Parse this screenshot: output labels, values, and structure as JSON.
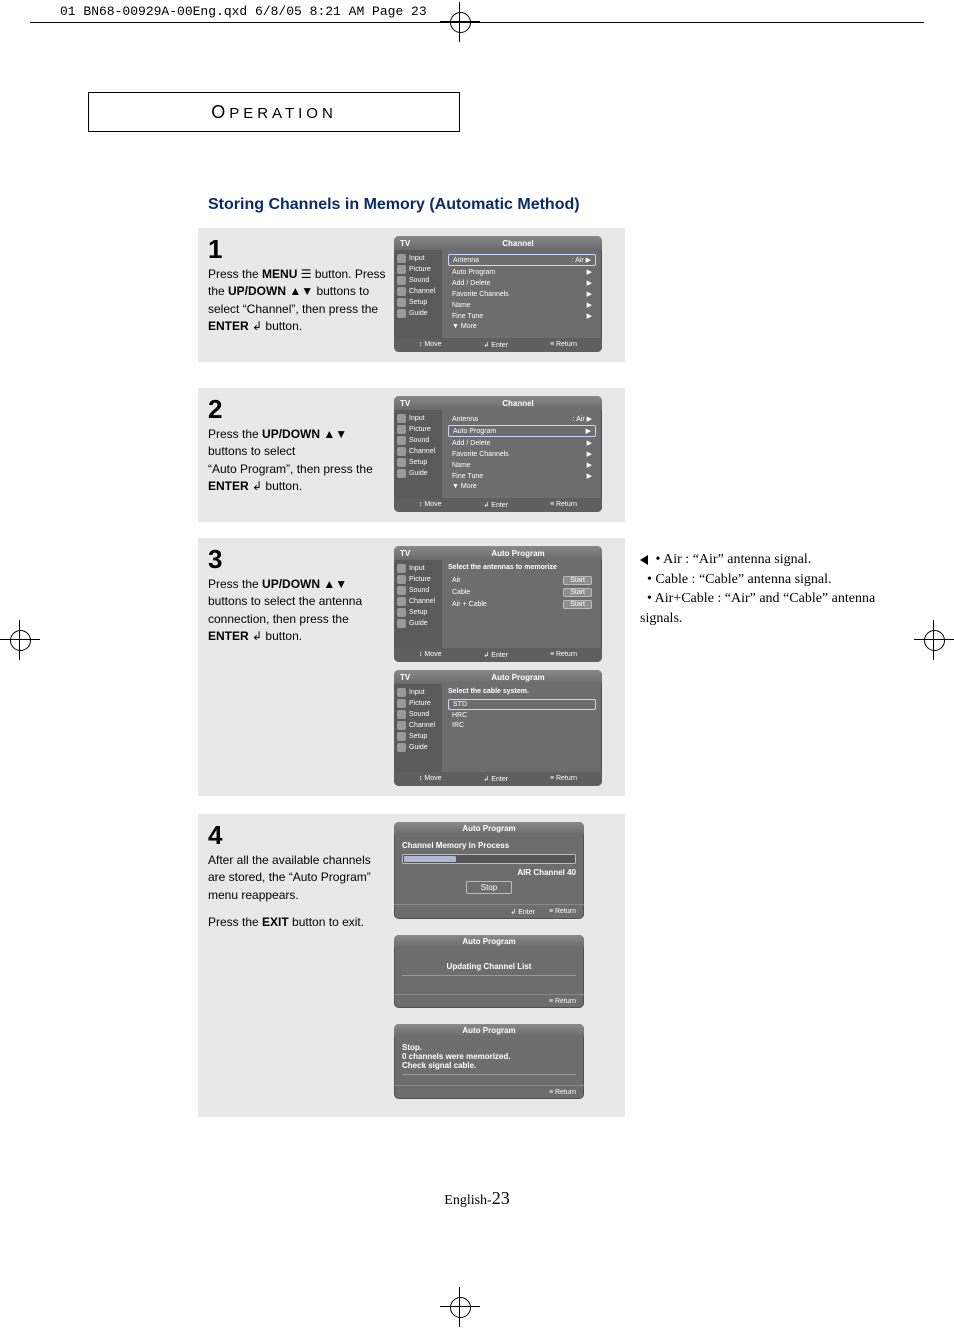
{
  "meta_header": "01 BN68-00929A-00Eng.qxd  6/8/05 8:21 AM  Page 23",
  "section_label": "OPERATION",
  "title": "Storing Channels in Memory (Automatic Method)",
  "steps": {
    "s1": {
      "num": "1",
      "text": "Press the MENU ≡ button. Press the UP/DOWN ▲▼ buttons to select “Channel”, then press the ENTER ↲ button."
    },
    "s2": {
      "num": "2",
      "text": "Press the UP/DOWN ▲▼ buttons to select “Auto Program”, then press the ENTER ↲ button."
    },
    "s3": {
      "num": "3",
      "text": "Press the UP/DOWN ▲▼ buttons to select the antenna connection, then press the ENTER ↲ button."
    },
    "s4": {
      "num": "4",
      "text_a": "After all the available channels are stored, the “Auto Program” menu reappears.",
      "text_b": "Press the EXIT button to exit."
    }
  },
  "osd": {
    "side_items": [
      "Input",
      "Picture",
      "Sound",
      "Channel",
      "Setup",
      "Guide"
    ],
    "tv_label": "TV",
    "channel_title": "Channel",
    "auto_program_title": "Auto Program",
    "menu": {
      "antenna": "Antenna",
      "antenna_val": ": Air",
      "auto_program": "Auto Program",
      "add_delete": "Add / Delete",
      "favorite": "Favorite Channels",
      "name": "Name",
      "fine_tune": "Fine Tune",
      "more": "▼ More"
    },
    "foot": {
      "move": "↕ Move",
      "enter": "↲ Enter",
      "return": "≡ Return"
    },
    "ap_select_ant": "Select the antennas to memorize",
    "ap_opts": {
      "air": "Air",
      "cable": "Cable",
      "both": "Air + Cable",
      "start": "Start"
    },
    "ap_select_cable": "Select the cable system.",
    "cable_sys": {
      "std": "STD",
      "hrc": "HRC",
      "irc": "IRC"
    },
    "progress": {
      "hdr": "Auto Program",
      "mem_in_process": "Channel Memory in Process",
      "air_ch": "AIR Channel  40",
      "stop": "Stop",
      "updating": "Updating Channel List",
      "stop_msg": "Stop.",
      "zero_mem": "0 channels were memorized.",
      "check": "Check signal cable."
    }
  },
  "sidenote": {
    "air": "Air : “Air” antenna signal.",
    "cable": "Cable : “Cable” antenna signal.",
    "both": "Air+Cable : “Air” and “Cable” antenna signals."
  },
  "page_footer": {
    "lang": "English-",
    "num": "23"
  }
}
